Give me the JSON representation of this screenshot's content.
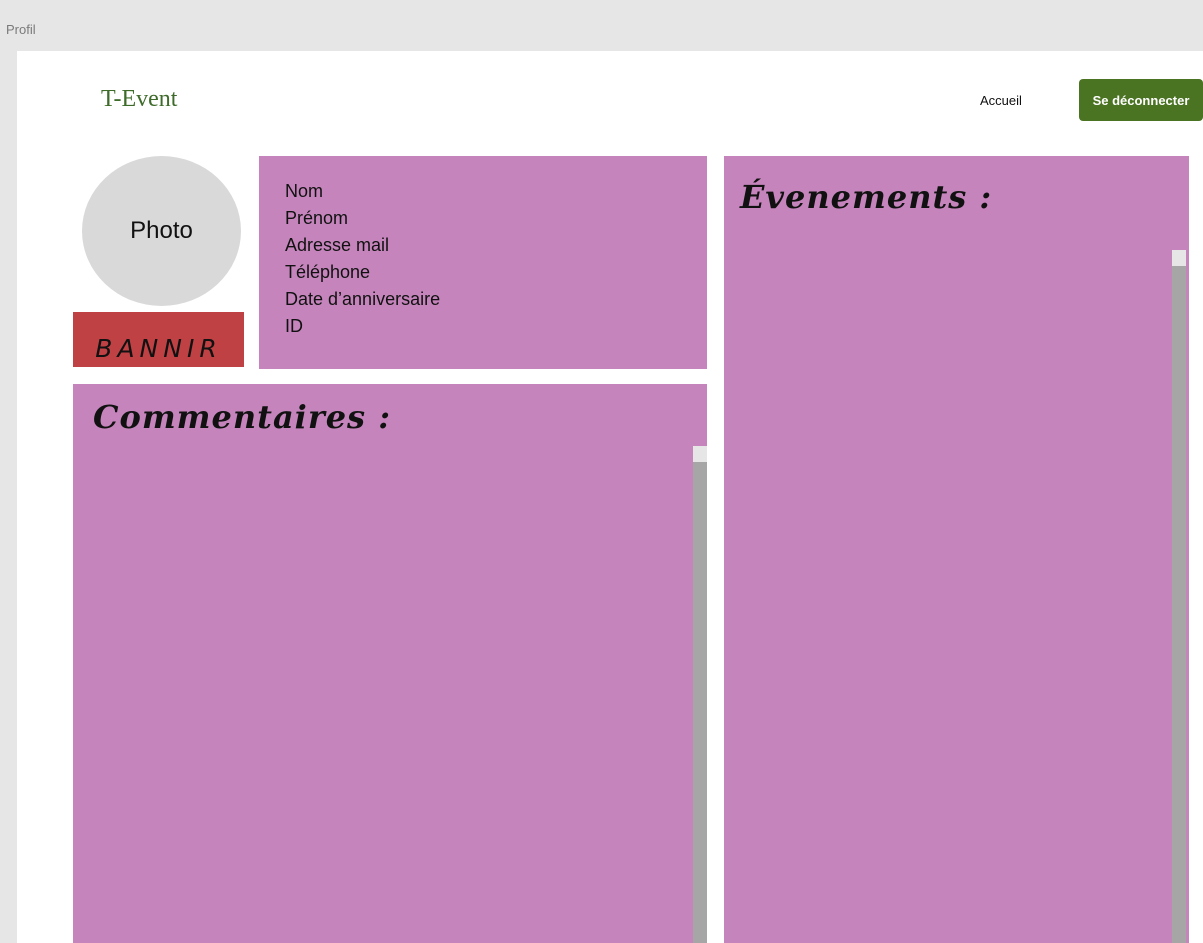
{
  "frame": {
    "label": "Profil"
  },
  "header": {
    "logo": "T-Event",
    "nav_home": "Accueil",
    "logout_label": "Se déconnecter"
  },
  "profile": {
    "photo_label": "Photo",
    "ban_label": "BANNIR",
    "fields": {
      "nom": "Nom",
      "prenom": "Prénom",
      "email": "Adresse mail",
      "telephone": "Téléphone",
      "birthday": "Date d’anniversaire",
      "id": "ID"
    }
  },
  "comments": {
    "title": "Commentaires :"
  },
  "events": {
    "title": "Évenements :"
  },
  "colors": {
    "panel": "#c585bc",
    "accent_green": "#4a7322",
    "logo_green": "#3e6b2a",
    "ban_red": "#bf4144"
  }
}
